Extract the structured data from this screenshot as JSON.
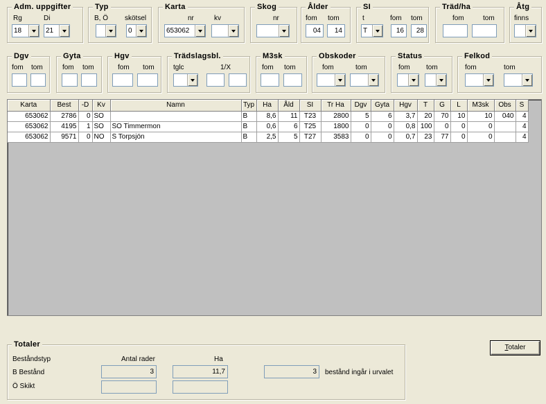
{
  "filters": {
    "adm": {
      "title": "Adm. uppgifter",
      "rg_label": "Rg",
      "di_label": "Di",
      "rg_value": "18",
      "di_value": "21"
    },
    "typ": {
      "title": "Typ",
      "bo_label": "B, Ö",
      "skotsel_label": "skötsel",
      "bo_value": "",
      "skotsel_value": "0"
    },
    "karta": {
      "title": "Karta",
      "nr_label": "nr",
      "kv_label": "kv",
      "nr_value": "653062",
      "kv_value": ""
    },
    "skog": {
      "title": "Skog",
      "nr_label": "nr",
      "nr_value": ""
    },
    "alder": {
      "title": "Ålder",
      "fom_label": "fom",
      "tom_label": "tom",
      "fom_value": "04",
      "tom_value": "14"
    },
    "si": {
      "title": "SI",
      "t_label": "t",
      "fom_label": "fom",
      "tom_label": "tom",
      "t_value": "T",
      "fom_value": "16",
      "tom_value": "28"
    },
    "trad_ha": {
      "title": "Träd/ha",
      "fom_label": "fom",
      "tom_label": "tom",
      "fom_value": "",
      "tom_value": ""
    },
    "atg": {
      "title": "Åtg",
      "finns_label": "finns",
      "finns_value": ""
    },
    "dgv": {
      "title": "Dgv",
      "fom_label": "fom",
      "tom_label": "tom",
      "fom_value": "",
      "tom_value": ""
    },
    "gyta": {
      "title": "Gyta",
      "fom_label": "fom",
      "tom_label": "tom",
      "fom_value": "",
      "tom_value": ""
    },
    "hgv": {
      "title": "Hgv",
      "fom_label": "fom",
      "tom_label": "tom",
      "fom_value": "",
      "tom_value": ""
    },
    "tradslag": {
      "title": "Trädslagsbl.",
      "tglc_label": "tglc",
      "x_label": "1/X",
      "tglc_value": "",
      "a_value": "",
      "b_value": ""
    },
    "m3sk": {
      "title": "M3sk",
      "fom_label": "fom",
      "tom_label": "tom",
      "fom_value": "",
      "tom_value": ""
    },
    "obskoder": {
      "title": "Obskoder",
      "fom_label": "fom",
      "tom_label": "tom",
      "fom_value": "",
      "tom_value": ""
    },
    "status": {
      "title": "Status",
      "fom_label": "fom",
      "tom_label": "tom",
      "fom_value": "",
      "tom_value": ""
    },
    "felkod": {
      "title": "Felkod",
      "fom_label": "fom",
      "tom_label": "tom",
      "fom_value": "",
      "tom_value": ""
    }
  },
  "table": {
    "columns": [
      "Karta",
      "Best",
      "-D",
      "Kv",
      "Namn",
      "Typ",
      "Ha",
      "Åld",
      "SI",
      "Tr Ha",
      "Dgv",
      "Gyta",
      "Hgv",
      "T",
      "G",
      "L",
      "M3sk",
      "Obs",
      "S"
    ],
    "rows": [
      [
        "653062",
        "2786",
        "0",
        "SO",
        "",
        "B",
        "8,6",
        "11",
        "T23",
        "2800",
        "5",
        "6",
        "3,7",
        "20",
        "70",
        "10",
        "10",
        "040",
        "4"
      ],
      [
        "653062",
        "4195",
        "1",
        "SO",
        "SO Timmermon",
        "B",
        "0,6",
        "6",
        "T25",
        "1800",
        "0",
        "0",
        "0,8",
        "100",
        "0",
        "0",
        "0",
        "",
        "4"
      ],
      [
        "653062",
        "9571",
        "0",
        "NO",
        "S Torpsjön",
        "B",
        "2,5",
        "5",
        "T27",
        "3583",
        "0",
        "0",
        "0,7",
        "23",
        "77",
        "0",
        "0",
        "",
        "4"
      ]
    ]
  },
  "totals": {
    "title": "Totaler",
    "bestandstyp_label": "Beståndstyp",
    "antal_rader_label": "Antal rader",
    "ha_label": "Ha",
    "b_label": "B Bestånd",
    "o_label": "Ö Skikt",
    "b_antal": "3",
    "b_ha": "11,7",
    "o_antal": "",
    "o_ha": "",
    "urval_count": "3",
    "urval_text": "bestånd ingår i urvalet"
  },
  "button": {
    "totaler_first": "T",
    "totaler_rest": "otaler"
  }
}
